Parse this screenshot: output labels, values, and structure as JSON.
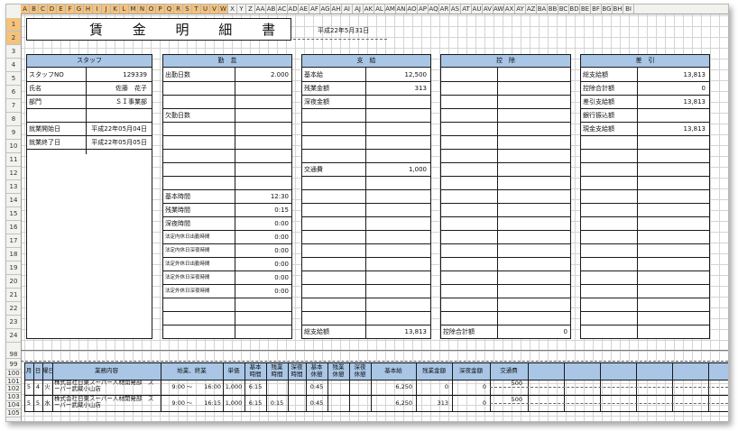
{
  "column_headers": [
    "A",
    "B",
    "C",
    "D",
    "E",
    "F",
    "G",
    "H",
    "I",
    "J",
    "K",
    "L",
    "M",
    "N",
    "O",
    "P",
    "Q",
    "R",
    "S",
    "T",
    "U",
    "V",
    "W",
    "X",
    "Y",
    "Z",
    "AA",
    "AB",
    "AC",
    "AD",
    "AE",
    "AF",
    "AG",
    "AH",
    "AI",
    "AJ",
    "AK",
    "AL",
    "AM",
    "AN",
    "AO",
    "AP",
    "AQ",
    "AR",
    "AS",
    "AT",
    "AU",
    "AV",
    "AW",
    "AX",
    "AY",
    "AZ",
    "BA",
    "BB",
    "BC",
    "BD",
    "BE",
    "BF",
    "BG",
    "BH",
    "BI"
  ],
  "row_headers": [
    "1",
    "2",
    "3",
    "4",
    "5",
    "6",
    "7",
    "8",
    "9",
    "10",
    "11",
    "12",
    "13",
    "14",
    "15",
    "16",
    "17",
    "18",
    "19",
    "20",
    "21",
    "22",
    "23",
    "24",
    "98",
    "99",
    "100",
    "101",
    "102",
    "103",
    "104",
    "105"
  ],
  "title": "賃 金 明 細 書",
  "date": "平成22年5月31日",
  "staff": {
    "header": "スタッフ",
    "rows": [
      {
        "label": "スタッフNO",
        "value": "129339"
      },
      {
        "label": "氏名",
        "value": "佐藤　花子"
      },
      {
        "label": "部門",
        "value": "ＳＩ事業部"
      },
      {
        "label": "",
        "value": ""
      },
      {
        "label": "就業開始日",
        "value": "平成22年05月04日"
      },
      {
        "label": "就業終了日",
        "value": "平成22年05月05日"
      }
    ]
  },
  "attendance": {
    "header": "勤　怠",
    "days_label": "出勤日数",
    "days_value": "2.000",
    "absent_label": "欠勤日数",
    "time_rows": [
      {
        "label": "基本時間",
        "value": "12:30"
      },
      {
        "label": "残業時間",
        "value": "0:15"
      },
      {
        "label": "深夜時間",
        "value": "0:00"
      },
      {
        "label": "法定内休日出勤時間",
        "value": "0:00"
      },
      {
        "label": "法定内休日深夜時間",
        "value": "0:00"
      },
      {
        "label": "法定外休日出勤時間",
        "value": "0:00"
      },
      {
        "label": "法定外休日深夜時間",
        "value": "0:00"
      },
      {
        "label": "法定外休日深夜時間",
        "value": "0:00"
      }
    ]
  },
  "payment": {
    "header": "支　給",
    "rows": [
      {
        "label": "基本給",
        "value": "12,500"
      },
      {
        "label": "残業金額",
        "value": "313"
      },
      {
        "label": "深夜金額",
        "value": ""
      }
    ],
    "transport_label": "交通費",
    "transport_value": "1,000",
    "total_label": "総支給額",
    "total_value": "13,813"
  },
  "deduction": {
    "header": "控　除",
    "total_label": "控除合計額",
    "total_value": "0"
  },
  "net": {
    "header": "差　引",
    "rows": [
      {
        "label": "総支給額",
        "value": "13,813"
      },
      {
        "label": "控除合計額",
        "value": "0"
      },
      {
        "label": "差引支給額",
        "value": "13,813"
      },
      {
        "label": "銀行振込額",
        "value": ""
      },
      {
        "label": "現金支給額",
        "value": "13,813"
      }
    ]
  },
  "detail": {
    "headers": [
      "月",
      "日",
      "曜日",
      "業務内容",
      "始業、終業",
      "単価",
      "基本時間",
      "残業時間",
      "深夜時間",
      "基本休憩",
      "残業休憩",
      "深夜休憩",
      "基本給",
      "残業金額",
      "深夜金額",
      "交通費"
    ],
    "rows": [
      {
        "month": "5",
        "day": "4",
        "weekday": "火",
        "work": "株式会社日東スーパー人材開発部　スーパー武蔵小山店",
        "start": "9:00",
        "tilde": "〜",
        "end": "16:00",
        "rate": "1,000",
        "basic": "6:15",
        "overtime": "",
        "night": "",
        "basic_break": "0:45",
        "ot_break": "",
        "night_break": "",
        "pay": "6,250",
        "ot_pay": "0",
        "night_pay": "0",
        "transport": "500"
      },
      {
        "month": "5",
        "day": "5",
        "weekday": "水",
        "work": "株式会社日東スーパー人材開発部　スーパー武蔵小山店",
        "start": "9:00",
        "tilde": "〜",
        "end": "16:15",
        "rate": "1,000",
        "basic": "6:15",
        "overtime": "0:15",
        "night": "",
        "basic_break": "0:45",
        "ot_break": "",
        "night_break": "",
        "pay": "6,250",
        "ot_pay": "313",
        "night_pay": "0",
        "transport": "500"
      }
    ]
  }
}
